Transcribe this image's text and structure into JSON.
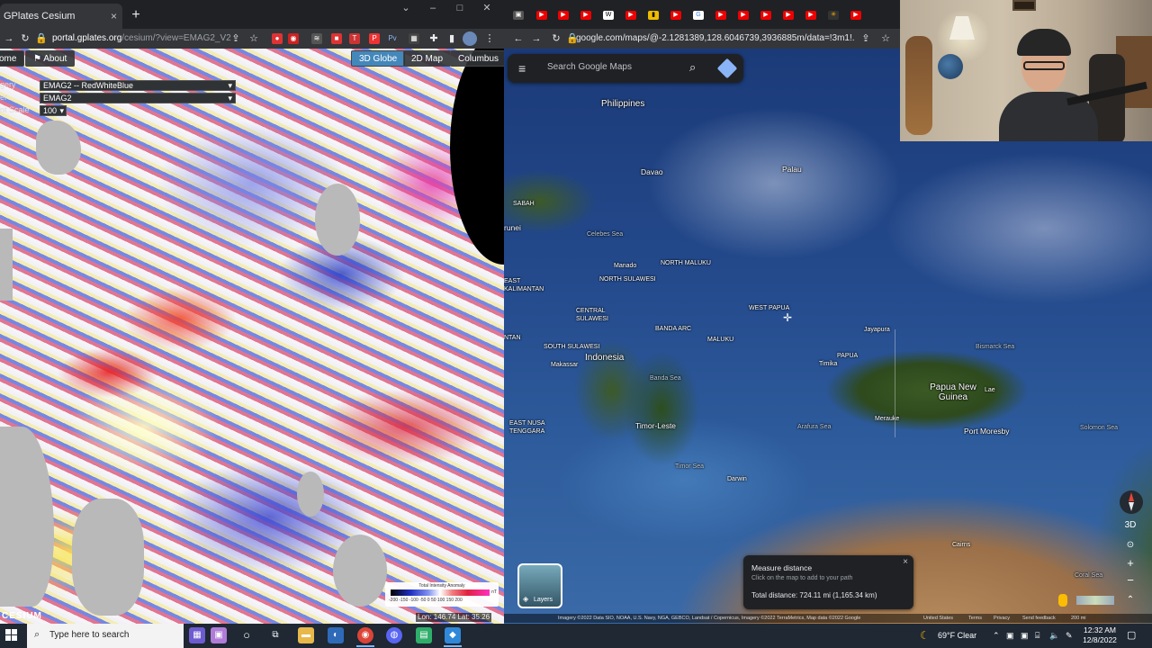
{
  "left_browser": {
    "tab_title": "GPlates Cesium",
    "tab_close": "×",
    "new_tab": "+",
    "address_host": "portal.gplates.org",
    "address_path": "/cesium/?view=EMAG2_V2",
    "win_min": "–",
    "win_max": "□",
    "win_close": "✕"
  },
  "cesium": {
    "nav_home": "ome",
    "nav_about": "About",
    "btn_3d_globe": "3D Globe",
    "btn_2d_map": "2D Map",
    "btn_columbus": "Columbus",
    "label_imagery": "gery",
    "label_layer": "er",
    "label_scale": "nt Scale",
    "select_imagery": "EMAG2 -- RedWhiteBlue",
    "select_layer": "EMAG2",
    "select_scale": "100",
    "colorbar_title": "Total Intensity Anomaly",
    "colorbar_unit": "nT",
    "colorbar_ticks": "-200 -150 -100 -50   0   50  100  150  200",
    "coordinates": "Lon: 146.74    Lat: 35.26",
    "logo": "CESIUM"
  },
  "right_browser": {
    "address": "google.com/maps/@-2.1281389,128.6046739,3936885m/data=!3m1!...",
    "search_placeholder": "Search Google Maps"
  },
  "map_labels": {
    "philippines": "Philippines",
    "davao": "Davao",
    "palau": "Palau",
    "brunei": "runei",
    "sabah": "SABAH",
    "celebes_sea": "Celebes Sea",
    "manado": "Manado",
    "north_maluku": "NORTH MALUKU",
    "north_sulawesi": "NORTH SULAWESI",
    "east_kalimantan": "EAST KALIMANTAN",
    "central_sulawesi": "CENTRAL SULAWESI",
    "west_papua": "WEST PAPUA",
    "jayapura": "Jayapura",
    "bismarck_sea": "Bismarck Sea",
    "banda_arc": "BANDA ARC",
    "maluku": "MALUKU",
    "papua": "PAPUA",
    "south_sulawesi": "SOUTH SULAWESI",
    "indonesia": "Indonesia",
    "makassar": "Makassar",
    "banda_sea": "Banda Sea",
    "timika": "Timika",
    "papua_new_guinea": "Papua New Guinea",
    "lae": "Lae",
    "port_moresby": "Port Moresby",
    "solomon_sea": "Solomon Sea",
    "arafura_sea": "Arafura Sea",
    "merauke": "Merauke",
    "east_nusa_tenggara": "EAST NUSA TENGGARA",
    "timor_leste": "Timor-Leste",
    "timor_sea": "Timor Sea",
    "darwin": "Darwin",
    "cairns": "Cairns",
    "coral_sea": "Coral Sea",
    "central_kalimantan": "NTAN"
  },
  "measure": {
    "title": "Measure distance",
    "hint": "Click on the map to add to your path",
    "total": "Total distance: 724.11 mi (1,165.34 km)",
    "close": "×"
  },
  "layers_label": "Layers",
  "map_controls": {
    "label_3d": "3D",
    "zoom_in": "+",
    "zoom_out": "−"
  },
  "attribution": {
    "imagery": "Imagery ©2022 Data SIO, NOAA, U.S. Navy, NGA, GEBCO, Landsat / Copernicus, Imagery ©2022 TerraMetrics, Map data ©2022 Google",
    "united_states": "United States",
    "terms": "Terms",
    "privacy": "Privacy",
    "feedback": "Send feedback",
    "scale": "200 mi"
  },
  "taskbar": {
    "search_placeholder": "Type here to search",
    "weather": "69°F  Clear",
    "time": "12:32 AM",
    "date": "12/8/2022"
  },
  "colors": {
    "chrome_dark": "#202124",
    "chrome_toolbar": "#35363a",
    "cesium_active": "#4488bb",
    "taskbar": "#1f2833",
    "map_ocean": "#244a8c"
  }
}
